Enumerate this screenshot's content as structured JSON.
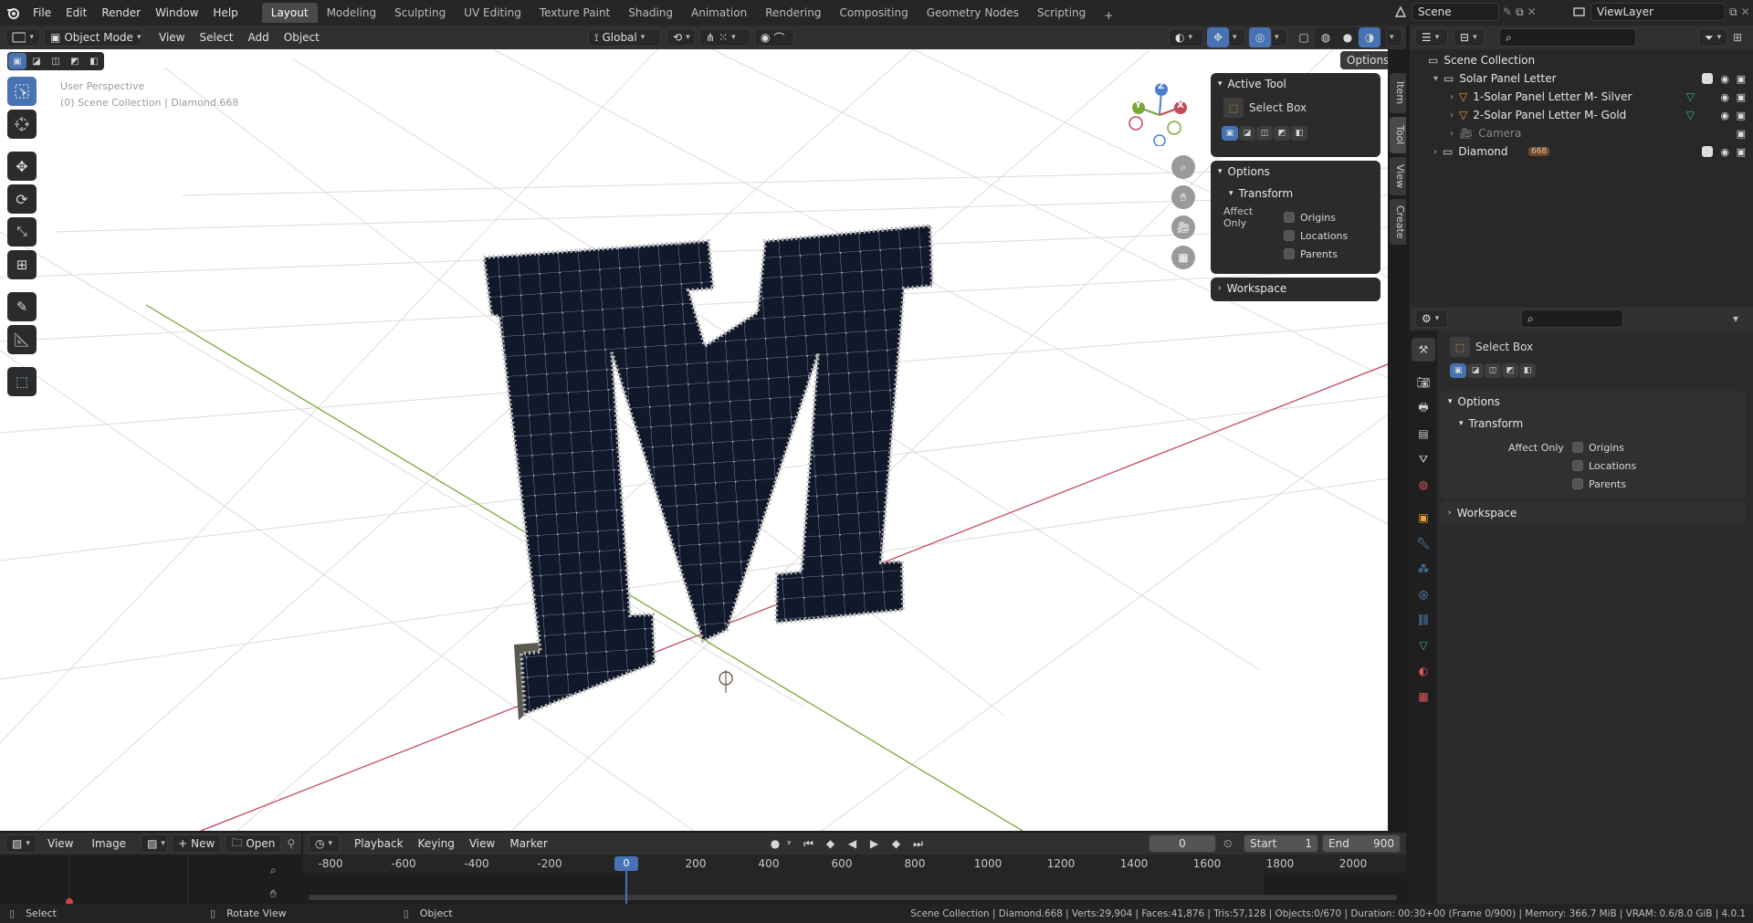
{
  "topbar": {
    "menus": [
      "File",
      "Edit",
      "Render",
      "Window",
      "Help"
    ],
    "workspaces": [
      "Layout",
      "Modeling",
      "Sculpting",
      "UV Editing",
      "Texture Paint",
      "Shading",
      "Animation",
      "Rendering",
      "Compositing",
      "Geometry Nodes",
      "Scripting"
    ],
    "active_workspace": "Layout",
    "add_tab_symbol": "+",
    "scene": "Scene",
    "view_layer": "ViewLayer"
  },
  "viewport": {
    "mode": "Object Mode",
    "menus": [
      "View",
      "Select",
      "Add",
      "Object"
    ],
    "orientation": "Global",
    "options_label": "Options",
    "overlay_line1": "User Perspective",
    "overlay_line2": "(0) Scene Collection | Diamond.668",
    "gizmo_axes": {
      "x": "X",
      "y": "Y",
      "z": "Z"
    },
    "side_tabs": [
      "Item",
      "Tool",
      "View",
      "Create"
    ]
  },
  "n_panel": {
    "active_tool_header": "Active Tool",
    "tool_name": "Select Box",
    "options_header": "Options",
    "transform_header": "Transform",
    "affect_only_label": "Affect Only",
    "affect_items": [
      "Origins",
      "Locations",
      "Parents"
    ],
    "workspace_header": "Workspace"
  },
  "outliner": {
    "root": "Scene Collection",
    "rows": [
      {
        "label": "Solar Panel Letter",
        "indent": 1,
        "kind": "collection"
      },
      {
        "label": "1-Solar Panel Letter M- Silver",
        "indent": 2,
        "kind": "mesh"
      },
      {
        "label": "2-Solar Panel Letter M- Gold",
        "indent": 2,
        "kind": "mesh"
      },
      {
        "label": "Camera",
        "indent": 2,
        "kind": "camera"
      },
      {
        "label": "Diamond",
        "indent": 1,
        "kind": "collection"
      }
    ],
    "diamond_badge": "668"
  },
  "properties": {
    "tool_name": "Select Box",
    "options_header": "Options",
    "transform_header": "Transform",
    "affect_only_label": "Affect Only",
    "affect_items": [
      "Origins",
      "Locations",
      "Parents"
    ],
    "workspace_header": "Workspace"
  },
  "image_editor": {
    "menus": [
      "View",
      "Image"
    ],
    "new_label": "New",
    "open_label": "Open"
  },
  "timeline": {
    "menus": [
      "Playback",
      "Keying",
      "View",
      "Marker"
    ],
    "current_frame": "0",
    "start_label": "Start",
    "start_value": "1",
    "end_label": "End",
    "end_value": "900",
    "ruler_ticks": [
      "-800",
      "-600",
      "-400",
      "-200",
      "0",
      "200",
      "400",
      "600",
      "800",
      "1000",
      "1200",
      "1400",
      "1600",
      "1800",
      "2000"
    ],
    "playhead": "0"
  },
  "statusbar": {
    "hint_select": "Select",
    "hint_rotate": "Rotate View",
    "hint_object": "Object",
    "stats": "Scene Collection | Diamond.668 | Verts:29,904 | Faces:41,876 | Tris:57,128 | Objects:0/670 | Duration: 00:30+00 (Frame 0/900) | Memory: 366.7 MiB | VRAM: 0.6/8.0 GiB | 4.0.1"
  },
  "colors": {
    "accent": "#4772b3",
    "header": "#303030",
    "panel": "#2b2b2b",
    "x_axis": "#c4495b",
    "y_axis": "#78a838",
    "z_axis": "#4a7fd6"
  }
}
